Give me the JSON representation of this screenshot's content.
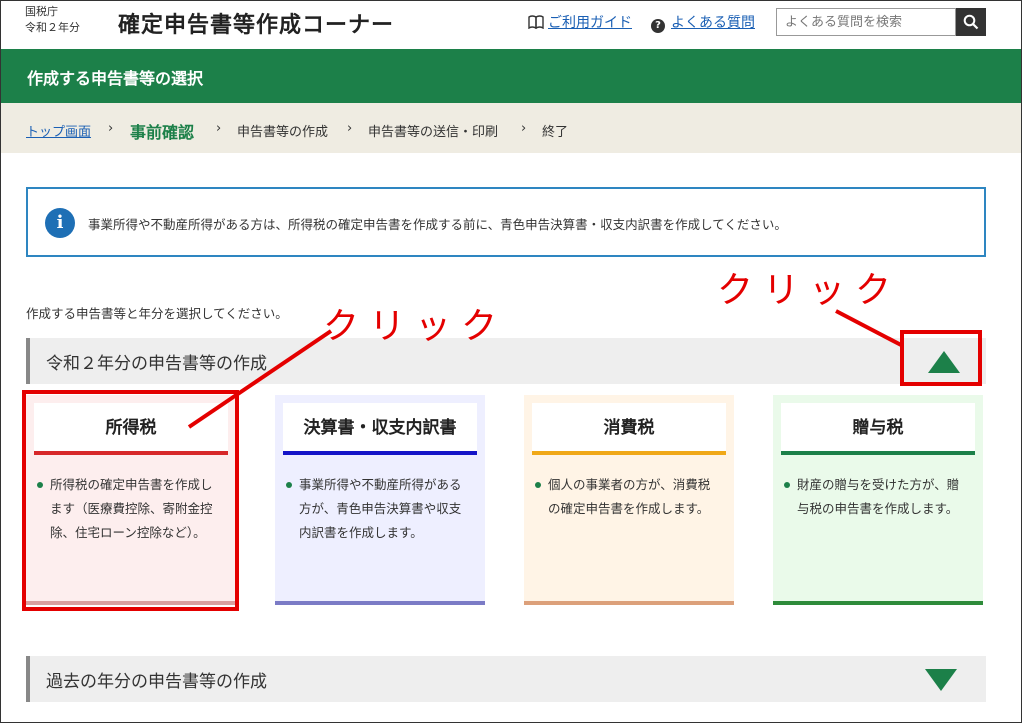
{
  "header": {
    "agency": "国税庁",
    "year": "令和２年分",
    "title": "確定申告書等作成コーナー",
    "guide_link": "ご利用ガイド",
    "faq_link": "よくある質問",
    "search_placeholder": "よくある質問を検索"
  },
  "page": {
    "heading": "作成する申告書等の選択"
  },
  "breadcrumb": {
    "items": [
      "トップ画面",
      "事前確認",
      "申告書等の作成",
      "申告書等の送信・印刷",
      "終了"
    ],
    "separator": "›"
  },
  "notice": {
    "icon_letter": "i",
    "text": "事業所得や不動産所得がある方は、所得税の確定申告書を作成する前に、青色申告決算書・収支内訳書を作成してください。"
  },
  "instruction": "作成する申告書等と年分を選択してください。",
  "sections": {
    "current": "令和２年分の申告書等の作成",
    "past": "過去の年分の申告書等の作成"
  },
  "cards": [
    {
      "title": "所得税",
      "desc": "所得税の確定申告書を作成します（医療費控除、寄附金控除、住宅ローン控除など）。"
    },
    {
      "title": "決算書・収支内訳書",
      "desc": "事業所得や不動産所得がある方が、青色申告決算書や収支内訳書を作成します。"
    },
    {
      "title": "消費税",
      "desc": "個人の事業者の方が、消費税の確定申告書を作成します。"
    },
    {
      "title": "贈与税",
      "desc": "財産の贈与を受けた方が、贈与税の申告書を作成します。"
    }
  ],
  "annotations": {
    "click_label_1": "クリック",
    "click_label_2": "クリック",
    "color": "#e40000"
  },
  "colors": {
    "brand_green": "#1c8049",
    "link_blue": "#1a5fb4",
    "info_blue": "#1e6fb5"
  },
  "icons": {
    "guide": "book-icon",
    "faq": "question-circle-icon",
    "search": "search-icon",
    "notice": "info-icon",
    "expand": "triangle-up-icon",
    "collapse": "triangle-down-icon"
  }
}
